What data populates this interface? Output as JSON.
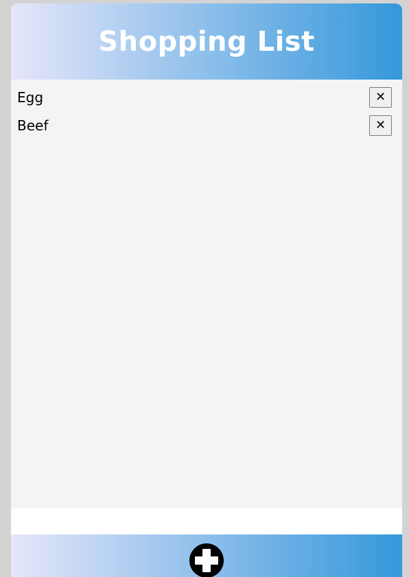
{
  "header": {
    "title": "Shopping List"
  },
  "list": {
    "items": [
      {
        "label": "Egg",
        "delete_label": "✕"
      },
      {
        "label": "Beef",
        "delete_label": "✕"
      }
    ]
  },
  "entry": {
    "value": ""
  },
  "footer": {
    "add_icon": "plus-circle-icon"
  },
  "colors": {
    "gradient_start": "#e6e6fa",
    "gradient_end": "#3498db",
    "list_background": "#f4f4f4",
    "page_background": "#d3d3d3"
  }
}
